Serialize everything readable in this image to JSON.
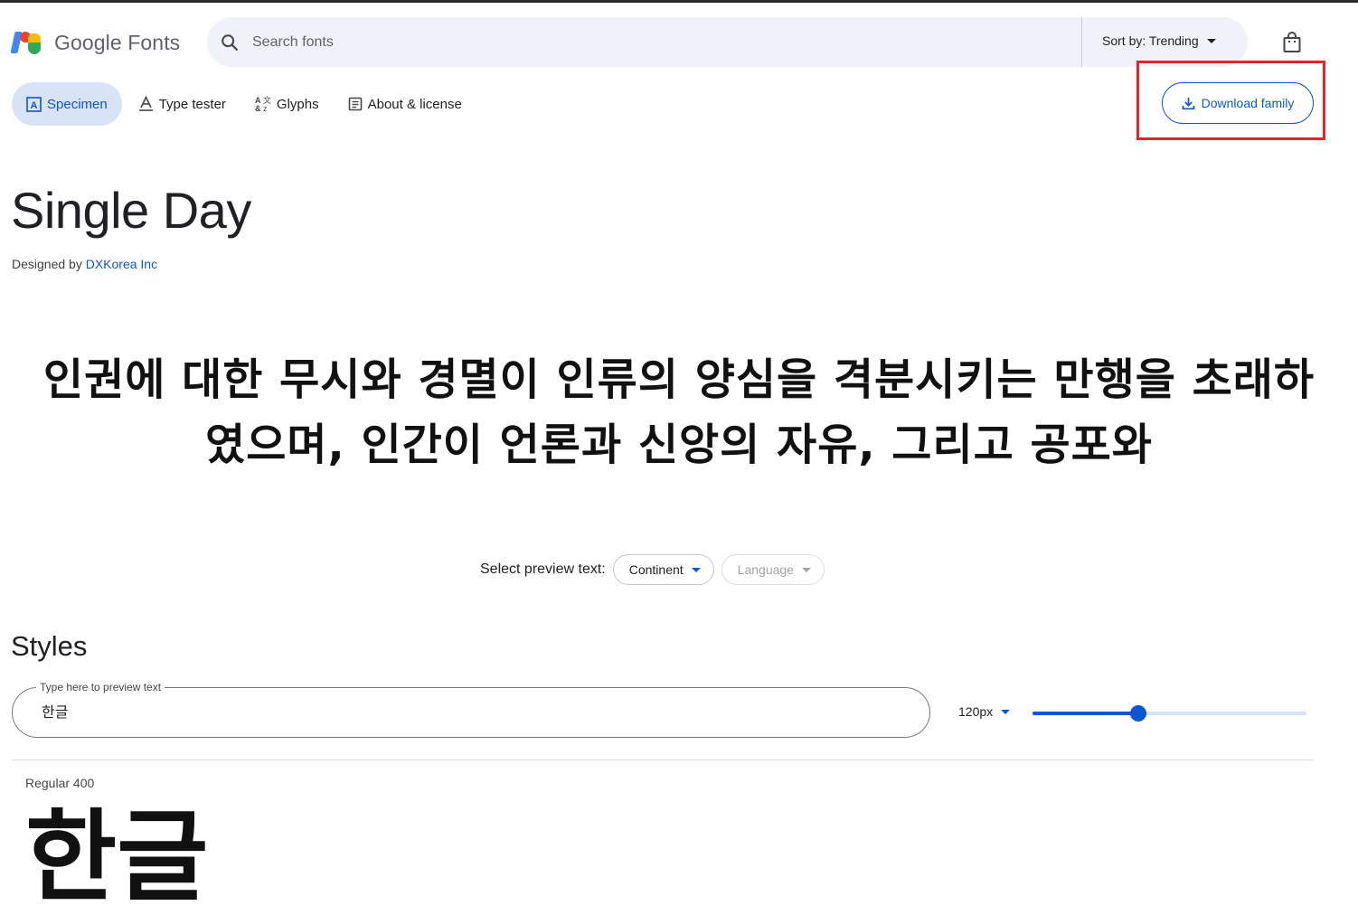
{
  "header": {
    "logo_text": "Google Fonts",
    "search_placeholder": "Search fonts",
    "sort_label": "Sort by: Trending"
  },
  "tabs": [
    {
      "label": "Specimen",
      "active": true
    },
    {
      "label": "Type tester",
      "active": false
    },
    {
      "label": "Glyphs",
      "active": false
    },
    {
      "label": "About & license",
      "active": false
    }
  ],
  "download_label": "Download family",
  "font": {
    "name": "Single Day",
    "designed_by_label": "Designed by",
    "designer": "DXKorea Inc"
  },
  "preview_text_line1": "인권에 대한 무시와 경멸이 인류의 양심을 격분시키는 만행을 초래하",
  "preview_text_line2": "였으며, 인간이 언론과 신앙의 자유, 그리고 공포와",
  "preview_controls": {
    "label": "Select preview text:",
    "continent": "Continent",
    "language": "Language"
  },
  "styles": {
    "heading": "Styles",
    "field_label": "Type here to preview text",
    "field_value": "한글",
    "size": "120px",
    "size_slider_fraction": 0.385,
    "style_name": "Regular 400",
    "sample_text": "한글"
  },
  "colors": {
    "accent": "#0b57d0",
    "highlight": "#e8212a"
  }
}
